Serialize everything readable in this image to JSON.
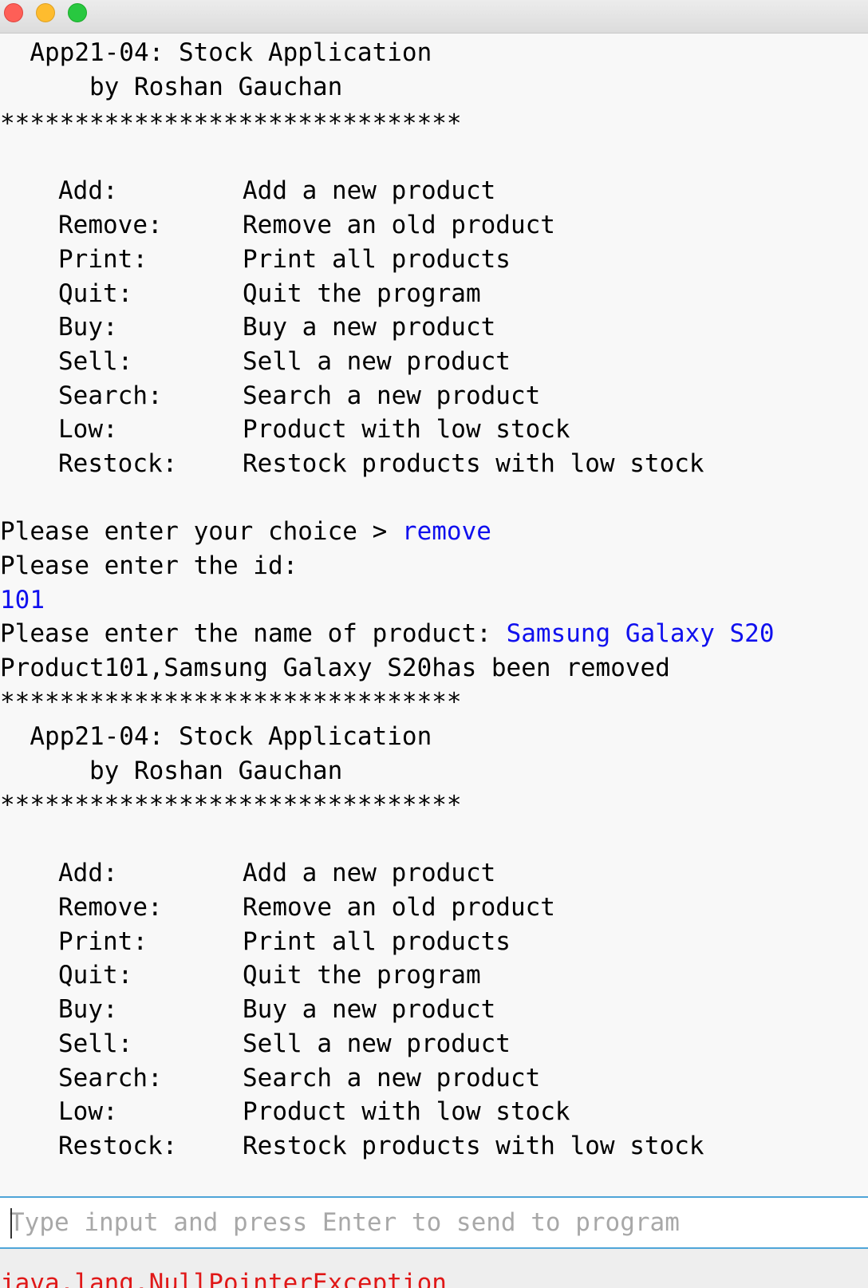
{
  "window": {
    "buttons": [
      "close",
      "minimize",
      "maximize"
    ]
  },
  "console": {
    "banner1": {
      "title": "  App21-04: Stock Application",
      "author": "      by Roshan Gauchan",
      "stars_bottom": "*******************************"
    },
    "menu1": [
      {
        "key": "Add:",
        "desc": "Add a new product"
      },
      {
        "key": "Remove:",
        "desc": "Remove an old product"
      },
      {
        "key": "Print:",
        "desc": "Print all products"
      },
      {
        "key": "Quit:",
        "desc": "Quit the program"
      },
      {
        "key": "Buy:",
        "desc": "Buy a new product"
      },
      {
        "key": "Sell:",
        "desc": "Sell a new product"
      },
      {
        "key": "Search:",
        "desc": "Search a new product"
      },
      {
        "key": "Low:",
        "desc": "Product with low stock"
      },
      {
        "key": "Restock:",
        "desc": "Restock products with low stock"
      }
    ],
    "prompt_choice": "Please enter your choice > ",
    "input_choice": "remove",
    "prompt_id": "Please enter the id:",
    "input_id": "101",
    "prompt_name": "Please enter the name of product: ",
    "input_name": "Samsung Galaxy S20",
    "removed_msg": "Product101,Samsung Galaxy S20has been removed",
    "banner2": {
      "stars_top": "*******************************",
      "title": "  App21-04: Stock Application",
      "author": "      by Roshan Gauchan",
      "stars_bottom": "*******************************"
    },
    "menu2": [
      {
        "key": "Add:",
        "desc": "Add a new product"
      },
      {
        "key": "Remove:",
        "desc": "Remove an old product"
      },
      {
        "key": "Print:",
        "desc": "Print all products"
      },
      {
        "key": "Quit:",
        "desc": "Quit the program"
      },
      {
        "key": "Buy:",
        "desc": "Buy a new product"
      },
      {
        "key": "Sell:",
        "desc": "Sell a new product"
      },
      {
        "key": "Search:",
        "desc": "Search a new product"
      },
      {
        "key": "Low:",
        "desc": "Product with low stock"
      },
      {
        "key": "Restock:",
        "desc": "Restock products with low stock"
      }
    ]
  },
  "input": {
    "placeholder": "Type input and press Enter to send to program",
    "value": ""
  },
  "error": {
    "text": "java.lang.NullPointerException"
  },
  "colors": {
    "user_input": "#1010ee",
    "error": "#e01818",
    "focus_border": "#4fa5d8"
  }
}
